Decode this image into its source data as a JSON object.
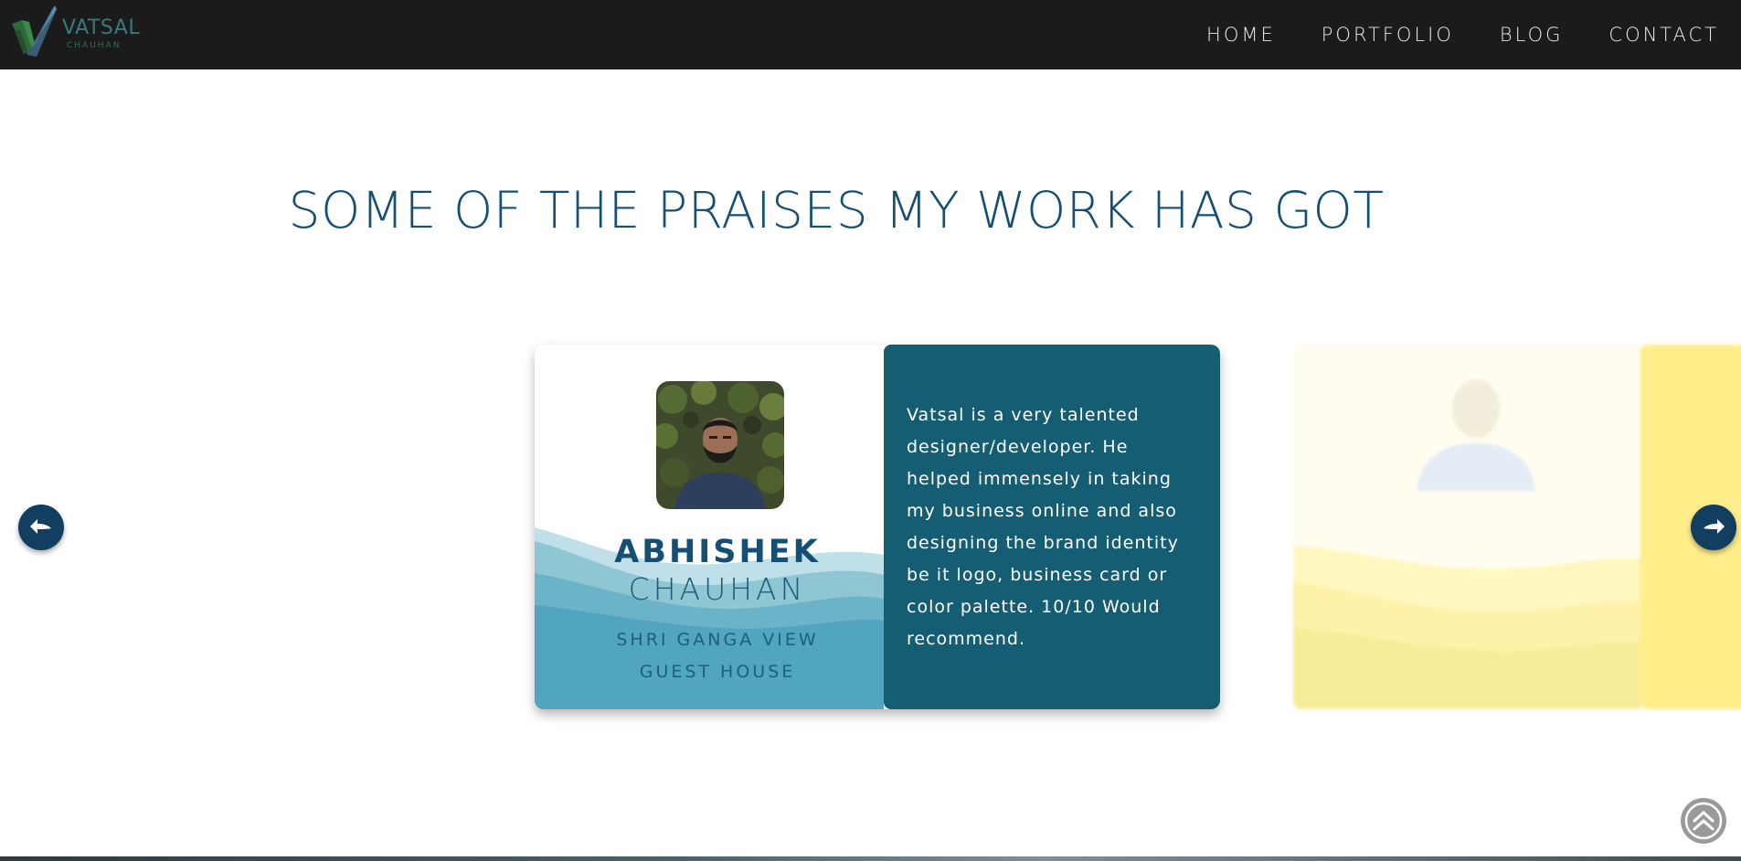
{
  "header": {
    "logo": {
      "name": "VATSAL",
      "sub": "CHAUHAN",
      "icon": "checkmark-v-icon"
    },
    "nav": [
      {
        "label": "HOME"
      },
      {
        "label": "PORTFOLIO"
      },
      {
        "label": "BLOG"
      },
      {
        "label": "CONTACT"
      }
    ]
  },
  "main": {
    "title": "SOME OF THE PRAISES MY WORK HAS GOT",
    "testimonials": [
      {
        "first_name": "ABHISHEK",
        "last_name": "CHAUHAN",
        "company": "SHRI GANGA VIEW GUEST HOUSE",
        "quote": "Vatsal is a very talented designer/developer. He helped immensely in taking my business online and also designing the brand identity be it logo, business card or color palette. 10/10 Would recommend.",
        "accent": "#155d72"
      },
      {
        "first_name": "",
        "accent": "#ffee8a"
      }
    ]
  },
  "controls": {
    "prev_icon": "arrow-left-icon",
    "next_icon": "arrow-right-icon",
    "back_to_top_icon": "double-chevron-up-icon"
  },
  "colors": {
    "navbar": "#1b1b1b",
    "title": "#154f73",
    "arrow": "#123e5f"
  }
}
